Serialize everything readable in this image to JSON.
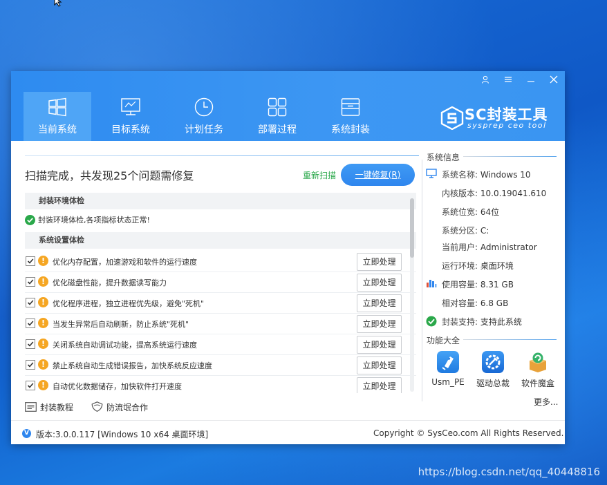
{
  "window": {
    "controls": [
      "user-icon",
      "menu-icon",
      "minimize-icon",
      "close-icon"
    ]
  },
  "tabs": [
    {
      "label": "当前系统",
      "icon": "windows-icon",
      "active": true
    },
    {
      "label": "目标系统",
      "icon": "monitor-icon",
      "active": false
    },
    {
      "label": "计划任务",
      "icon": "clock-icon",
      "active": false
    },
    {
      "label": "部署过程",
      "icon": "grid-icon",
      "active": false
    },
    {
      "label": "系统封装",
      "icon": "package-icon",
      "active": false
    }
  ],
  "logo": {
    "main": "SC封装工具",
    "sub": "sysprep ceo tool"
  },
  "scan": {
    "title": "扫描完成，共发现25个问题需修复",
    "rescan": "重新扫描",
    "fix_label": "一键修复",
    "fix_hotkey": "(R)"
  },
  "sections": {
    "env_header": "封装环境体检",
    "env_status": "封装环境体检,各项指标状态正常!",
    "settings_header": "系统设置体检"
  },
  "issues": [
    {
      "text": "优化内存配置，加速游戏和软件的运行速度",
      "checked": true,
      "action": "立即处理"
    },
    {
      "text": "优化磁盘性能，提升数据读写能力",
      "checked": true,
      "action": "立即处理"
    },
    {
      "text": "优化程序进程，独立进程优先级，避免\"死机\"",
      "checked": true,
      "action": "立即处理"
    },
    {
      "text": "当发生异常后自动刷新，防止系统\"死机\"",
      "checked": true,
      "action": "立即处理"
    },
    {
      "text": "关闭系统自动调试功能，提高系统运行速度",
      "checked": true,
      "action": "立即处理"
    },
    {
      "text": "禁止系统自动生成错误报告，加快系统反应速度",
      "checked": true,
      "action": "立即处理"
    },
    {
      "text": "自动优化数据储存，加快软件打开速度",
      "checked": true,
      "action": "立即处理"
    }
  ],
  "bottom_links": {
    "tutorial": "封装教程",
    "partner": "防流氓合作"
  },
  "footer": {
    "version": "版本:3.0.0.117 [Windows 10 x64 桌面环境]",
    "copyright": "Copyright © SysCeo.com All Rights Reserved.",
    "badge": "V"
  },
  "system_info": {
    "title": "系统信息",
    "rows": [
      {
        "key": "系统名称:",
        "value": "Windows 10"
      },
      {
        "key": "内核版本:",
        "value": "10.0.19041.610"
      },
      {
        "key": "系统位宽:",
        "value": "64位"
      },
      {
        "key": "系统分区:",
        "value": "C:"
      },
      {
        "key": "当前用户:",
        "value": "Administrator"
      },
      {
        "key": "运行环境:",
        "value": "桌面环境"
      },
      {
        "key": "使用容量:",
        "value": "8.31 GB"
      },
      {
        "key": "相对容量:",
        "value": "6.8 GB"
      },
      {
        "key": "封装支持:",
        "value": "支持此系统"
      }
    ]
  },
  "tools": {
    "title": "功能大全",
    "items": [
      {
        "label": "Usm_PE",
        "icon": "usb-icon",
        "color": "#2f8ff0"
      },
      {
        "label": "驱动总裁",
        "icon": "driver-icon",
        "color": "#1f88e6"
      },
      {
        "label": "软件魔盒",
        "icon": "magic-box-icon",
        "color": "#e8a23a"
      }
    ],
    "more": "更多..."
  },
  "watermark": "https://blog.csdn.net/qq_40448816",
  "colors": {
    "accent": "#2f86ee",
    "header": "#3a95f2",
    "warning": "#f5a623",
    "success": "#2aa84a"
  }
}
